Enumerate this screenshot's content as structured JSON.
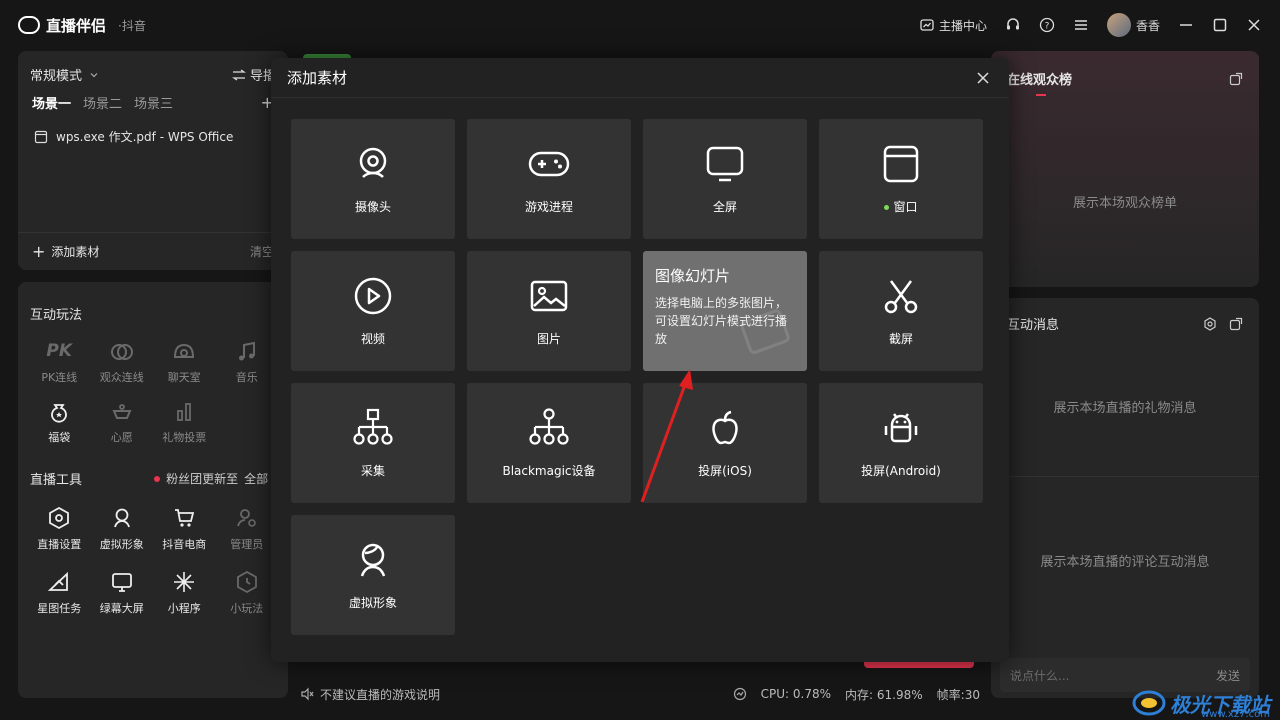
{
  "titlebar": {
    "app_name": "直播伴侣",
    "app_sub": "·抖音",
    "anchor_center": "主播中心",
    "username": "香香"
  },
  "scenes": {
    "mode": "常规模式",
    "guide": "导播",
    "tabs": [
      "场景一",
      "场景二",
      "场景三"
    ],
    "source": "wps.exe 作文.pdf - WPS Office",
    "add_source": "添加素材",
    "clear": "清空"
  },
  "interactive": {
    "title": "互动玩法",
    "items": [
      "PK连线",
      "观众连线",
      "聊天室",
      "音乐",
      "福袋",
      "心愿",
      "礼物投票"
    ]
  },
  "tools": {
    "title": "直播工具",
    "notice": "粉丝团更新至",
    "all": "全部",
    "items": [
      "直播设置",
      "虚拟形象",
      "抖音电商",
      "管理员",
      "星图任务",
      "绿幕大屏",
      "小程序",
      "小玩法"
    ]
  },
  "right": {
    "audience_title": "在线观众榜",
    "audience_empty": "展示本场观众榜单",
    "messages_title": "互动消息",
    "gift_empty": "展示本场直播的礼物消息",
    "comment_empty": "展示本场直播的评论互动消息",
    "chat_placeholder": "说点什么...",
    "send": "发送"
  },
  "modal": {
    "title": "添加素材",
    "tiles": [
      "摄像头",
      "游戏进程",
      "全屏",
      "窗口",
      "视频",
      "图片",
      "图像幻灯片",
      "截屏",
      "采集",
      "Blackmagic设备",
      "投屏(iOS)",
      "投屏(Android)",
      "虚拟形象"
    ],
    "hover": {
      "title": "图像幻灯片",
      "desc": "选择电脑上的多张图片，可设置幻灯片模式进行播放"
    }
  },
  "status": {
    "notice": "不建议直播的游戏说明",
    "cpu": "CPU: 0.78%",
    "mem": "内存: 61.98%",
    "fps": "帧率:30"
  },
  "watermark": {
    "text": "极光下载站",
    "url": "www.xz7.com"
  },
  "colors": {
    "accent_red": "#e8344e",
    "online_green": "#7ed957",
    "arrow": "#e02020"
  }
}
